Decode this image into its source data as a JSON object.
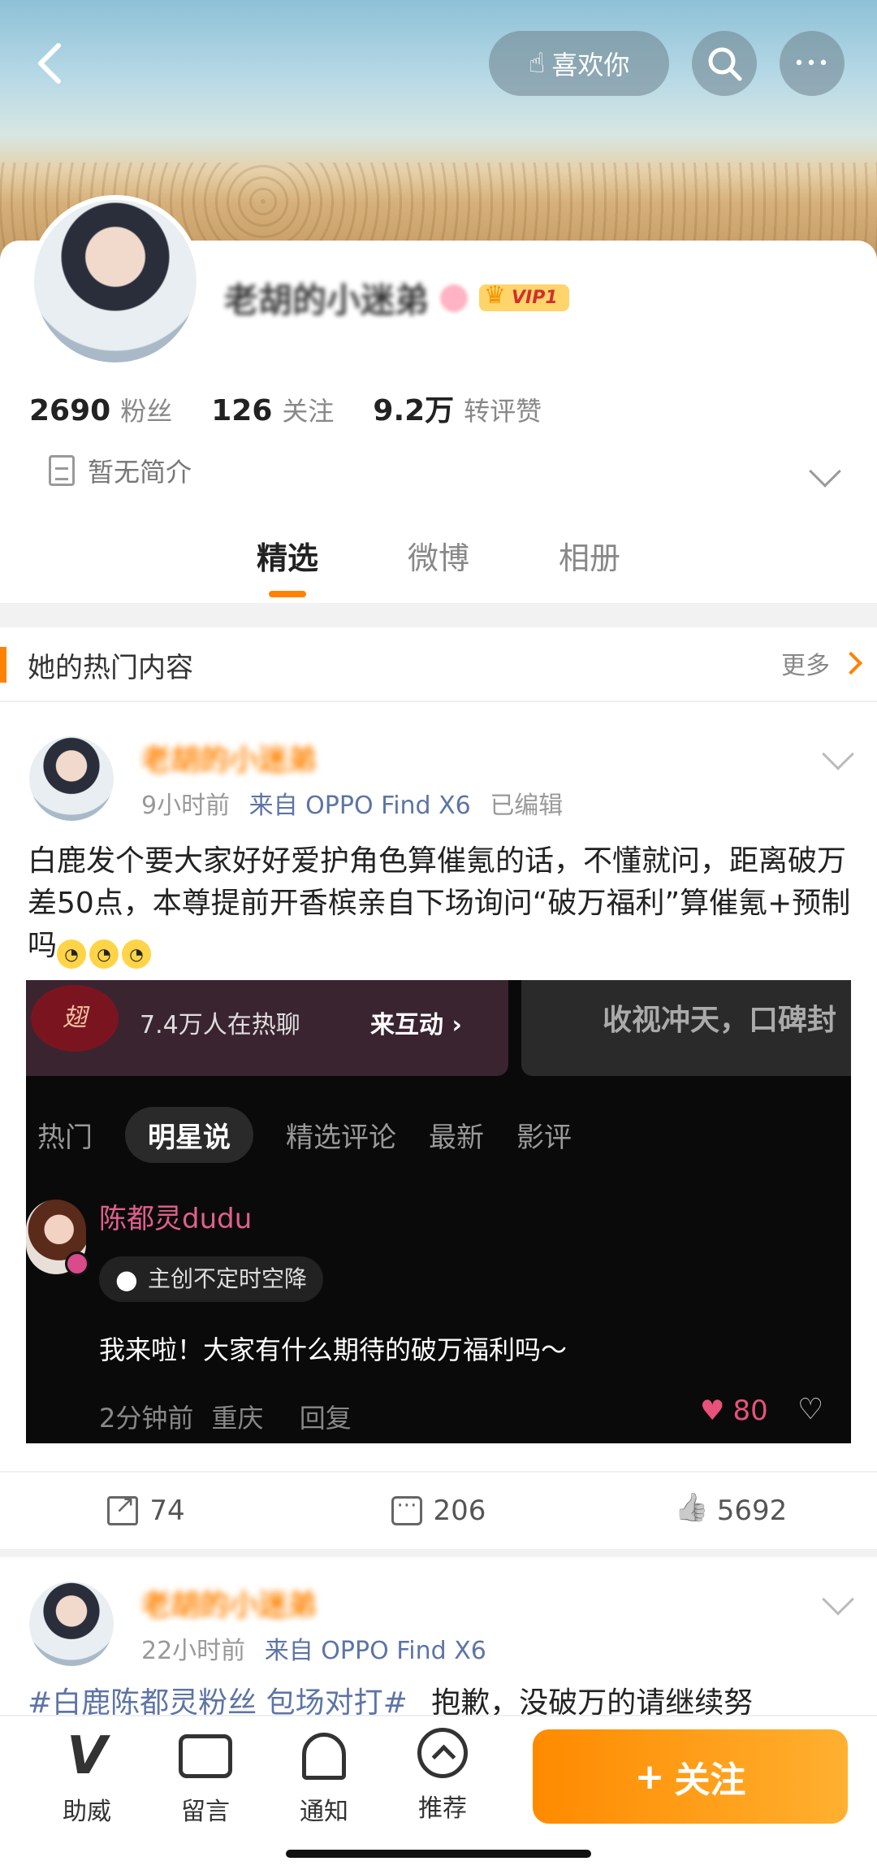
{
  "header": {
    "like_label": "喜欢你",
    "more_glyph": "•••"
  },
  "profile": {
    "name": "老胡的小迷弟",
    "vip_label": "VIP1",
    "stats": [
      {
        "num": "2690",
        "label": "粉丝"
      },
      {
        "num": "126",
        "label": "关注"
      },
      {
        "num": "9.2万",
        "label": "转评赞"
      }
    ],
    "bio": "暂无简介",
    "tabs": [
      "精选",
      "微博",
      "相册"
    ],
    "active_tab": "精选"
  },
  "section": {
    "title": "她的热门内容",
    "more_label": "更多"
  },
  "post1": {
    "author": "老胡的小迷弟",
    "time": "9小时前",
    "source": "来自 OPPO Find X6",
    "edited": "已编辑",
    "text": "白鹿发个要大家好好爱护角色算催氪的话，不懂就问，距离破万差50点，本尊提前开香槟亲自下场询问“破万福利”算催氪+预制吗",
    "screenshot": {
      "logo_text": "翅",
      "hot_count": "7.4万人在热聊",
      "interact": "来互动 ›",
      "right_banner": "收视冲天，口碑封",
      "filters": [
        "热门",
        "明星说",
        "精选评论",
        "最新",
        "影评"
      ],
      "active_filter": "明星说",
      "commenter": "陈都灵dudu",
      "tag": "主创不定时空降",
      "comment": "我来啦！大家有什么期待的破万福利吗～",
      "comment_time": "2分钟前",
      "comment_location": "重庆",
      "reply_label": "回复",
      "likes": "80"
    },
    "reposts": "74",
    "comments": "206",
    "likes": "5692"
  },
  "post2": {
    "author": "老胡的小迷弟",
    "time": "22小时前",
    "source": "来自 OPPO Find X6",
    "hashtag": "#白鹿陈都灵粉丝 包场对打#",
    "text": "抱歉，没破万的请继续努"
  },
  "bottom": {
    "items": [
      {
        "label": "助威"
      },
      {
        "label": "留言"
      },
      {
        "label": "通知"
      },
      {
        "label": "推荐"
      }
    ],
    "follow_label": "关注"
  }
}
